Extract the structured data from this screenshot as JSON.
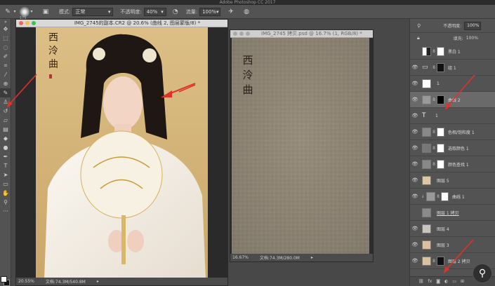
{
  "app_title": "Adobe Photoshop CC 2017",
  "options": {
    "brush_size": "175",
    "mode_label": "模式:",
    "mode_value": "正常",
    "opacity_label": "不透明度:",
    "opacity_value": "40%",
    "flow_label": "流量:",
    "flow_value": "100%"
  },
  "doc1": {
    "title": "IMG_2745的副本.CR2 @ 20.6% (曲线 2, 图层蒙版/8) *",
    "status_zoom": "20.55%",
    "status_doc": "文档:74.3M/540.8M",
    "calligraphy": [
      "西",
      "泠",
      "曲"
    ]
  },
  "doc2": {
    "title": "IMG_2745 拷贝.psd @ 16.7% (1, RGB/8) *",
    "status_zoom": "16.67%",
    "status_doc": "文档:74.3M/280.0M",
    "calligraphy": [
      "西",
      "泠",
      "曲"
    ]
  },
  "panel": {
    "opacity_label": "不透明度:",
    "opacity_value": "100%",
    "fill_label": "填充:",
    "fill_value": "100%",
    "layers": [
      {
        "name": "黑白 1"
      },
      {
        "name": "组 1"
      },
      {
        "name": "1"
      },
      {
        "name": "曲线 2"
      },
      {
        "name": "1"
      },
      {
        "name": "色相/饱和度 1"
      },
      {
        "name": "选取颜色 1"
      },
      {
        "name": "颜色查找 1"
      },
      {
        "name": "图层 5"
      },
      {
        "name": "曲线 1"
      },
      {
        "name": "图层 1 拷贝"
      },
      {
        "name": "图层 4"
      },
      {
        "name": "图层 3"
      },
      {
        "name": "图层 2 拷贝"
      }
    ]
  },
  "colors": {
    "accent_arrow": "#e0312b",
    "selected_layer": "#6a6a6a"
  }
}
